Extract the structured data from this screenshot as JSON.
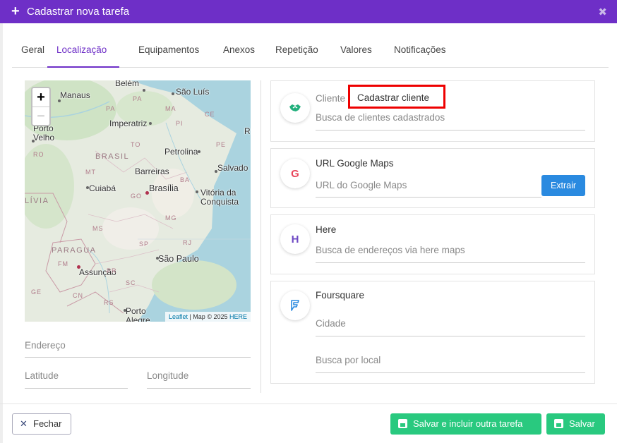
{
  "header": {
    "title": "Cadastrar nova tarefa",
    "plus_icon": "+",
    "close_icon": "✖"
  },
  "tabs": [
    {
      "label": "Geral"
    },
    {
      "label": "Localização",
      "active": true
    },
    {
      "label": "Equipamentos"
    },
    {
      "label": "Anexos"
    },
    {
      "label": "Repetição"
    },
    {
      "label": "Valores"
    },
    {
      "label": "Notificações"
    }
  ],
  "map": {
    "zoom_in": "+",
    "zoom_out": "−",
    "attribution": {
      "leaflet": "Leaflet",
      "sep": " | Map © 2025 ",
      "here": "HERE"
    },
    "cities": {
      "belem": "Belém",
      "manaus": "Manaus",
      "sao_luis": "São Luís",
      "porto_velho_1": "Porto",
      "porto_velho_2": "Velho",
      "imperatriz": "Imperatriz",
      "petrolina": "Petrolina",
      "barreiras": "Barreiras",
      "salvador": "Salvado",
      "cuiaba": "Cuiabá",
      "brasilia": "Brasília",
      "vitoria_1": "Vitória da",
      "vitoria_2": "Conquista",
      "assuncao": "Assunção",
      "sao_paulo": "São Paulo",
      "porto_alegre_1": "Porto",
      "porto_alegre_2": "Alegre",
      "recife_partial": "R"
    },
    "regions": {
      "brasil": "BRASIL",
      "paraguai": "PARAGUA",
      "bolivia": "LÍVIA",
      "pa": "PA",
      "ma": "MA",
      "mt": "MT",
      "go": "GO",
      "ba": "BA",
      "ms": "MS",
      "mg": "MG",
      "sp": "SP",
      "rj": "RJ",
      "pr": "PR",
      "sc": "SC",
      "rs": "RS",
      "pi": "PI",
      "to": "TO",
      "ro": "RO",
      "ce": "CE",
      "pe": "PE",
      "fm": "FM",
      "cn": "CN",
      "ge": "GE"
    }
  },
  "left_fields": {
    "endereco": "Endereço",
    "latitude": "Latitude",
    "longitude": "Longitude"
  },
  "cards": {
    "cliente": {
      "label": "Cliente",
      "placeholder": "Busca de clientes cadastrados",
      "icon": "handshake-icon",
      "color": "#22b07d"
    },
    "google": {
      "label": "URL Google Maps",
      "placeholder": "URL do Google Maps",
      "icon": "google-icon",
      "icon_text": "G",
      "button": "Extrair",
      "color": "#e8455a"
    },
    "here": {
      "label": "Here",
      "placeholder": "Busca de endereços via here maps",
      "icon": "here-icon",
      "icon_text": "H",
      "color": "#6e49c4"
    },
    "foursquare": {
      "label": "Foursquare",
      "placeholder_city": "Cidade",
      "placeholder_local": "Busca por local",
      "icon": "foursquare-icon",
      "color": "#2a8ae0"
    }
  },
  "highlight": {
    "label": "Cadastrar cliente"
  },
  "footer": {
    "fechar": "Fechar",
    "salvar_incluir": "Salvar e incluir outra tarefa",
    "salvar": "Salvar"
  }
}
